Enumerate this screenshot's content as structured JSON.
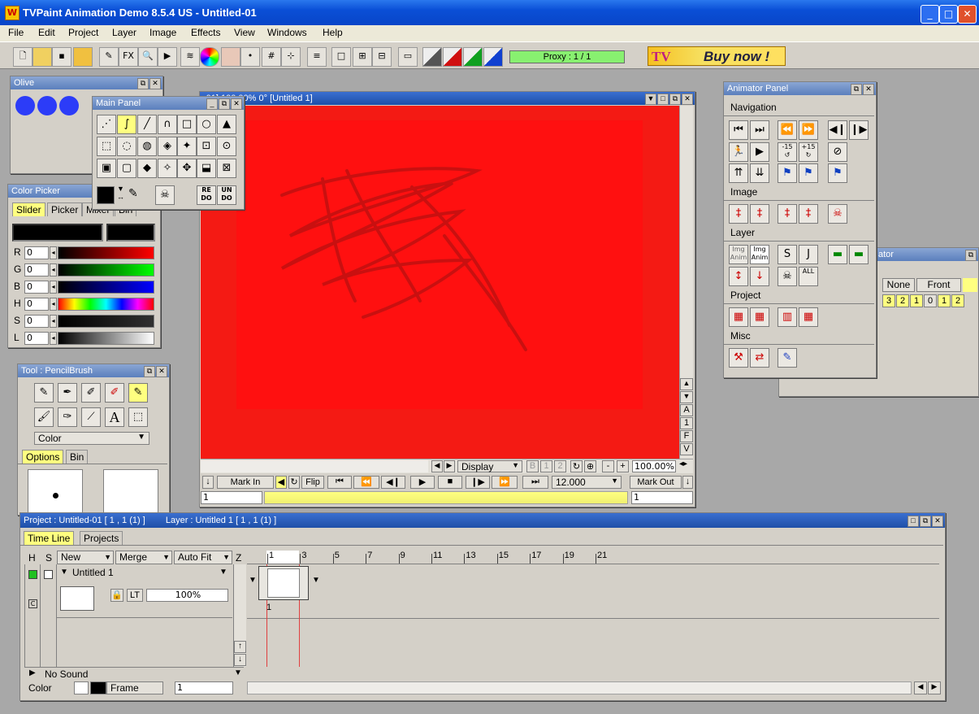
{
  "app": {
    "title": "TVPaint Animation Demo 8.5.4 US - Untitled-01"
  },
  "menu": [
    "File",
    "Edit",
    "Project",
    "Layer",
    "Image",
    "Effects",
    "View",
    "Windows",
    "Help"
  ],
  "toolbar": {
    "proxy": "Proxy : 1 / 1",
    "buy_now": "Buy now !",
    "fx": "FX"
  },
  "olive": {
    "title": "Olive"
  },
  "main_panel": {
    "title": "Main Panel",
    "redo": "RE DO",
    "undo": "UN DO"
  },
  "color_picker": {
    "title": "Color Picker",
    "tabs": [
      "Slider",
      "Picker",
      "Mixer",
      "Bin"
    ],
    "channels": [
      {
        "label": "R",
        "value": "0"
      },
      {
        "label": "G",
        "value": "0"
      },
      {
        "label": "B",
        "value": "0"
      },
      {
        "label": "H",
        "value": "0"
      },
      {
        "label": "S",
        "value": "0"
      },
      {
        "label": "L",
        "value": "0"
      }
    ]
  },
  "tool_panel": {
    "title": "Tool : PencilBrush",
    "color_select": "Color",
    "tabs": [
      "Options",
      "Bin"
    ]
  },
  "canvas": {
    "title_fragment": "-01]  100.00%  0°  [Untitled 1]",
    "display": "Display",
    "zoom": "100.00%",
    "b_label": "B",
    "marks": [
      "1",
      "2"
    ],
    "mark_in": "Mark In",
    "flip": "Flip",
    "fps": "12.000",
    "mark_out": "Mark Out",
    "frame_in": "1",
    "frame_out": "1",
    "side_letters": [
      "A",
      "1",
      "F",
      "V"
    ]
  },
  "animator": {
    "title": "Animator Panel",
    "sections": [
      "Navigation",
      "Image",
      "Layer",
      "Project",
      "Misc"
    ],
    "small_labels": {
      "plus15": "+15",
      "minus15": "-15",
      "img_anim_1": "Img Anim",
      "img_anim_2": "Img Anim",
      "all": "ALL"
    }
  },
  "behind_panel": {
    "title_fragment": "ator",
    "none": "None",
    "front": "Front",
    "numbers": [
      "3",
      "2",
      "1",
      "0",
      "1",
      "2"
    ]
  },
  "timeline": {
    "project_info": "Project : Untitled-01 [ 1 , 1  (1) ]",
    "layer_info": "Layer : Untitled 1 [ 1 , 1  (1) ]",
    "tabs": [
      "Time Line",
      "Projects"
    ],
    "headers": {
      "h": "H",
      "s": "S",
      "new": "New",
      "merge": "Merge",
      "auto_fit": "Auto Fit",
      "z": "Z"
    },
    "layer_name": "Untitled 1",
    "lt": "LT",
    "opacity": "100%",
    "ruler": [
      "1",
      "3",
      "5",
      "7",
      "9",
      "11",
      "13",
      "15",
      "17",
      "19",
      "21"
    ],
    "frame_number": "1",
    "no_sound": "No Sound",
    "color_label": "Color",
    "frame_label": "Frame",
    "frame_value": "1",
    "c_label": "C"
  },
  "colors": {
    "canvas_red": "#f41a14",
    "accent_yellow": "#ffff80",
    "proxy_green": "#88f070"
  }
}
